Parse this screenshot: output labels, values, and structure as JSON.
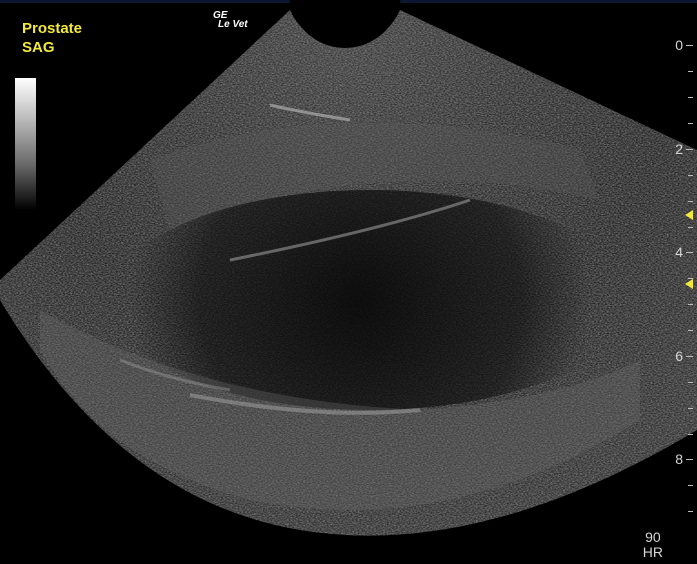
{
  "annotation": {
    "organ": "Prostate",
    "plane": "SAG"
  },
  "brand": {
    "line1": "GE",
    "line2": "Le Vet"
  },
  "depth_scale": {
    "labels": [
      "0",
      "2",
      "4",
      "6",
      "8"
    ],
    "focus_markers_count": 2
  },
  "readout": {
    "value": "90",
    "label": "HR"
  },
  "colors": {
    "annotation_text": "#f2e93a",
    "scale_text": "#d6d6d6",
    "background": "#000000"
  }
}
